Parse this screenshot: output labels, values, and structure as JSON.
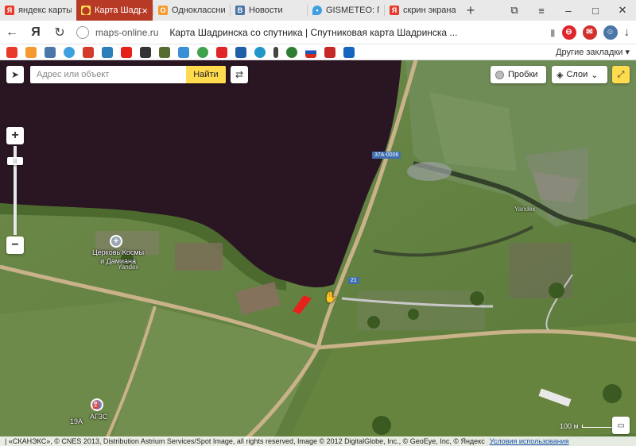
{
  "tabs": [
    {
      "label": "яндекс карты",
      "icon": "yandex-icon",
      "color": "#e8392a",
      "active": false
    },
    {
      "label": "Карта Шадр",
      "icon": "maps-pin-icon",
      "color": "#ffdb4d",
      "active": true
    },
    {
      "label": "Одноклассни",
      "icon": "odnoklassniki-icon",
      "color": "#f59a2e",
      "active": false
    },
    {
      "label": "Новости",
      "icon": "vk-icon",
      "color": "#4a76a8",
      "active": false
    },
    {
      "label": "GISMETEO: П",
      "icon": "gismeteo-drop-icon",
      "color": "#3fa0e0",
      "active": false
    },
    {
      "label": "скрин экрана",
      "icon": "yandex-icon",
      "color": "#e8392a",
      "active": false
    }
  ],
  "tab_close": "×",
  "new_tab": "+",
  "window_controls": {
    "pin": "⧉",
    "menu": "≡",
    "minimize": "–",
    "maximize": "□",
    "close": "✕"
  },
  "addressbar": {
    "back": "←",
    "yandex": "Я",
    "reload": "↻",
    "domain": "maps-online.ru",
    "page_title": "Карта Шадринска со спутника | Спутниковая карта Шадринска ...",
    "bookmark_star": "▮",
    "download": "↓"
  },
  "bookmarks": {
    "icons": [
      "yandex",
      "ok",
      "vk",
      "drop",
      "arrow",
      "chart",
      "youtube",
      "shield",
      "bird",
      "grid",
      "leaf",
      "mail",
      "grid2",
      "circle",
      "j",
      "globe",
      "flag-ru",
      "plane",
      "eagle"
    ],
    "other_label": "Другие закладки",
    "other_arrow": "▾"
  },
  "map": {
    "search_placeholder": "Адрес или объект",
    "find_label": "Найти",
    "traffic_label": "Пробки",
    "layers_label": "Слои",
    "layers_arrow": "⌄",
    "zoom_in": "+",
    "zoom_out": "−",
    "zoom_thumb": "|||",
    "church_label_1": "Церковь Космы",
    "church_label_2": "и Дамиана",
    "church_icon_glyph": "+",
    "gas_label": "АГЗС",
    "gas_icon_glyph": "⛽",
    "road_id": "19А",
    "shield_1": "37А-0006",
    "shield_2": "21",
    "watermark": "Yandex",
    "scale_label": "100 м",
    "copyright": "| «СКАНЭКС», © CNES 2013, Distribution Astrium Services/Spot Image, all rights reserved, Image © 2012 DigitalGlobe, Inc., © GeoEye, Inc, © Яндекс",
    "terms_label": "Условия использования"
  },
  "colors": {
    "accent_yellow": "#ffdb4d",
    "tab_active": "#b63a25",
    "lake": "#2a1623"
  }
}
